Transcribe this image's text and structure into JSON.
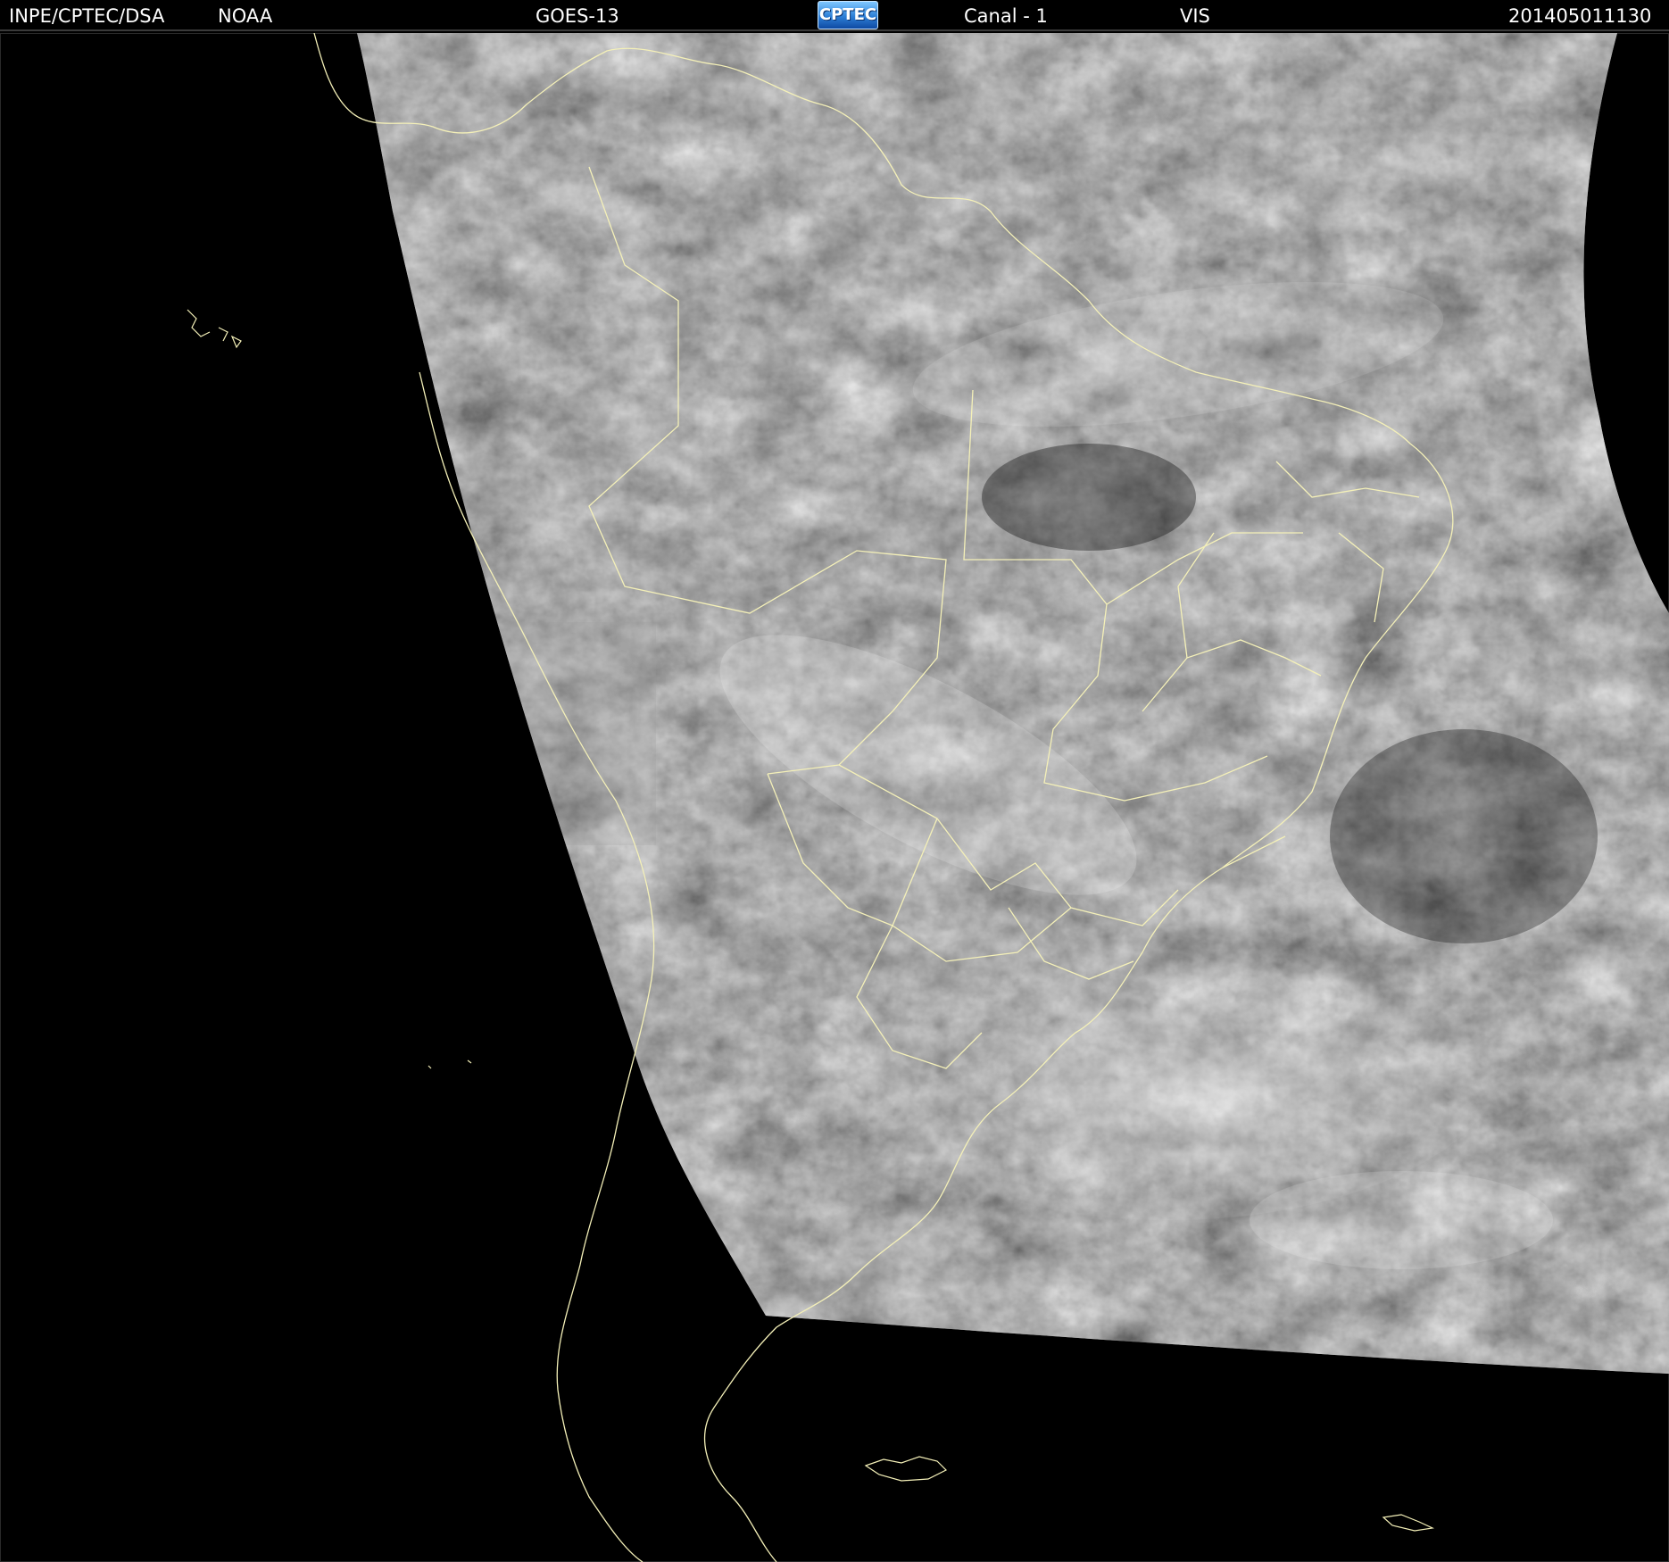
{
  "header": {
    "agency": "INPE/CPTEC/DSA",
    "source": "NOAA",
    "satellite": "GOES-13",
    "logo_text": "CPTEC",
    "channel": "Canal - 1",
    "band": "VIS",
    "timestamp": "201405011130"
  },
  "colors": {
    "background": "#000000",
    "header_text": "#ffffff",
    "coastline": "#f4f0b8",
    "logo_blue": "#2d7fd6"
  },
  "icons": {
    "logo": "cptec-logo"
  }
}
